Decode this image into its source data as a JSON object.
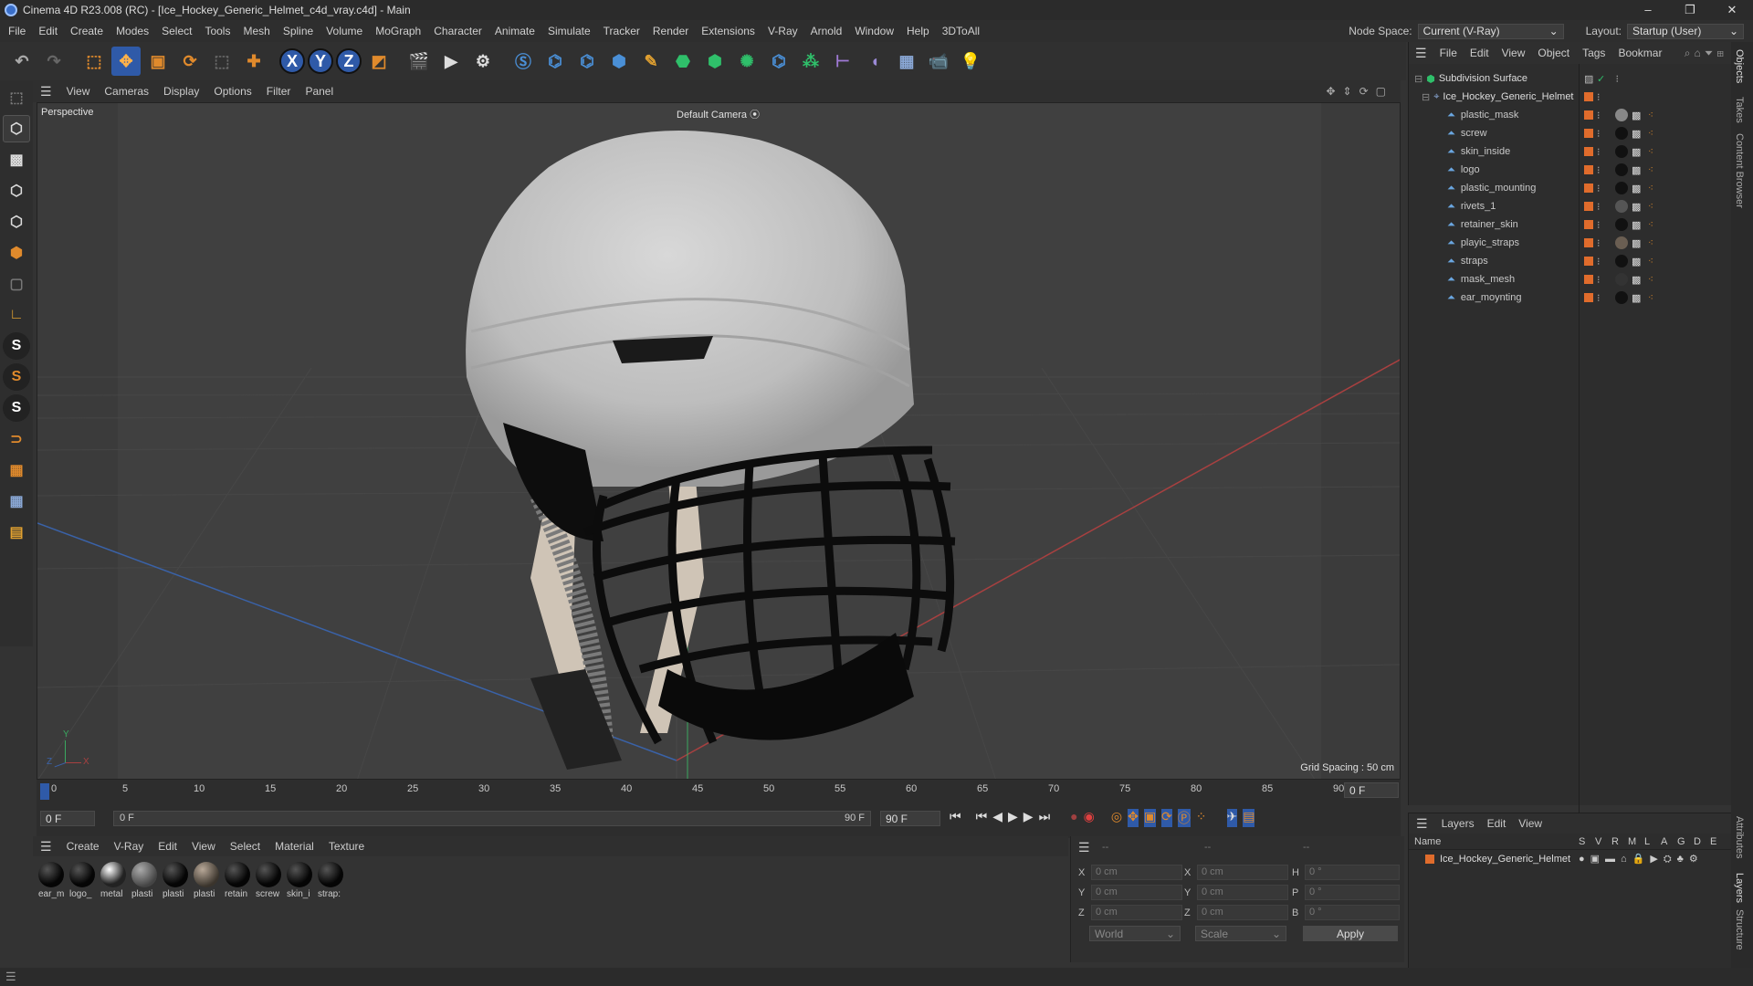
{
  "window": {
    "title": "Cinema 4D R23.008 (RC) - [Ice_Hockey_Generic_Helmet_c4d_vray.c4d] - Main",
    "min": "–",
    "restore": "❐",
    "close": "✕"
  },
  "menubar": [
    "File",
    "Edit",
    "Create",
    "Modes",
    "Select",
    "Tools",
    "Mesh",
    "Spline",
    "Volume",
    "MoGraph",
    "Character",
    "Animate",
    "Simulate",
    "Tracker",
    "Render",
    "Extensions",
    "V-Ray",
    "Arnold",
    "Window",
    "Help",
    "3DToAll"
  ],
  "node_space": {
    "label": "Node Space:",
    "value": "Current (V-Ray)"
  },
  "layout": {
    "label": "Layout:",
    "value": "Startup (User)"
  },
  "toolbar": {
    "axis_x": "X",
    "axis_y": "Y",
    "axis_z": "Z"
  },
  "viewport": {
    "menu": [
      "View",
      "Cameras",
      "Display",
      "Options",
      "Filter",
      "Panel"
    ],
    "label": "Perspective",
    "camera": "Default Camera",
    "grid_spacing": "Grid Spacing : 50 cm",
    "axis_x": "X",
    "axis_y": "Y",
    "axis_z": "Z"
  },
  "timeline": {
    "ticks": [
      "0",
      "5",
      "10",
      "15",
      "20",
      "25",
      "30",
      "35",
      "40",
      "45",
      "50",
      "55",
      "60",
      "65",
      "70",
      "75",
      "80",
      "85",
      "90"
    ],
    "current": "0 F",
    "start": "0 F",
    "range_start": "0 F",
    "range_end": "90 F",
    "end": "90 F"
  },
  "materials": {
    "menu": [
      "Create",
      "V-Ray",
      "Edit",
      "View",
      "Select",
      "Material",
      "Texture"
    ],
    "items": [
      "ear_m",
      "logo_",
      "metal",
      "plasti",
      "plasti",
      "plasti",
      "retain",
      "screw",
      "skin_i",
      "strap:"
    ]
  },
  "coords": {
    "x": "X",
    "y": "Y",
    "z": "Z",
    "h": "H",
    "p": "P",
    "b": "B",
    "pos": "0 cm",
    "size": "0 cm",
    "rot": "0 °",
    "header1": "--",
    "header2": "--",
    "header3": "--",
    "world": "World",
    "scale": "Scale",
    "apply": "Apply"
  },
  "object_manager": {
    "menu": [
      "File",
      "Edit",
      "View",
      "Object",
      "Tags",
      "Bookmar"
    ],
    "root": "Subdivision Surface",
    "group": "Ice_Hockey_Generic_Helmet",
    "objects": [
      "plastic_mask",
      "screw",
      "skin_inside",
      "logo",
      "plastic_mounting",
      "rivets_1",
      "retainer_skin",
      "playic_straps",
      "straps",
      "mask_mesh",
      "ear_moynting"
    ]
  },
  "layers": {
    "menu": [
      "Layers",
      "Edit",
      "View"
    ],
    "header_name": "Name",
    "cols": [
      "S",
      "V",
      "R",
      "M",
      "L",
      "A",
      "G",
      "D",
      "E"
    ],
    "item": "Ice_Hockey_Generic_Helmet"
  },
  "right_tabs": [
    "Objects",
    "Takes",
    "Content Browser",
    "Attributes",
    "Layers",
    "Structure"
  ],
  "colors": {
    "accent_orange": "#e06c2c",
    "selection_blue": "#2f5aa8",
    "icon_blue": "#4a8fd6"
  }
}
